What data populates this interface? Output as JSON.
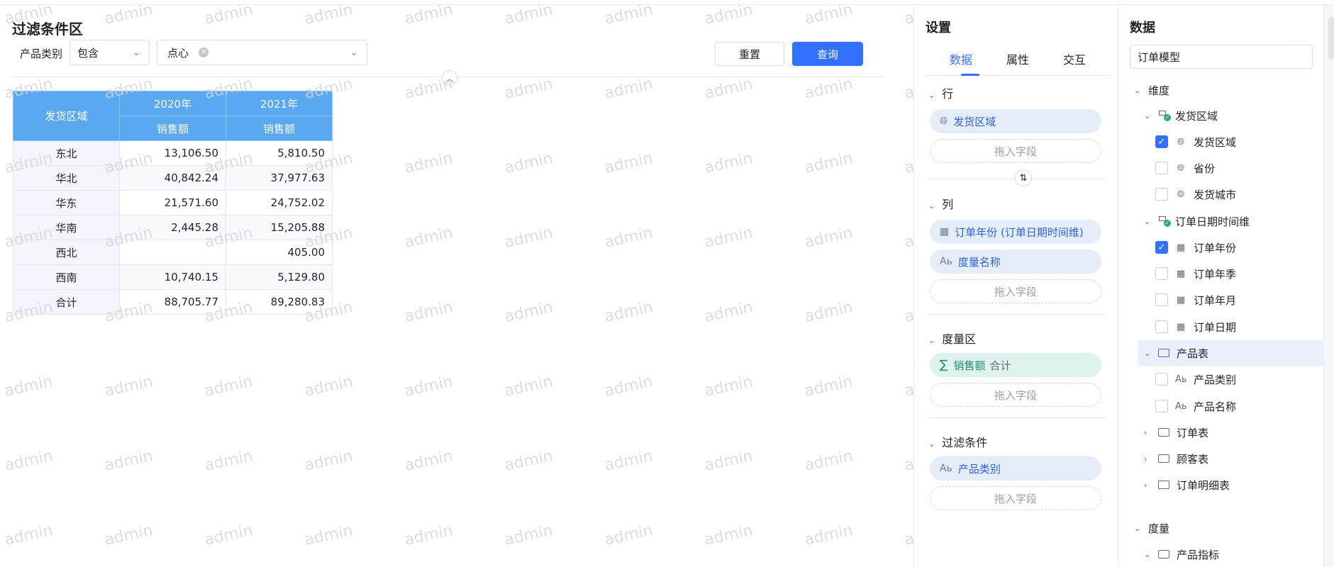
{
  "watermark_text": "admin",
  "filter": {
    "title": "过滤条件区",
    "label": "产品类别",
    "operator": "包含",
    "tag": "点心",
    "reset_label": "重置",
    "query_label": "查询"
  },
  "table": {
    "row_header": "发货区域",
    "years": [
      "2020年",
      "2021年"
    ],
    "measure": "销售额",
    "rows": [
      {
        "region": "东北",
        "v2020": "13,106.50",
        "v2021": "5,810.50"
      },
      {
        "region": "华北",
        "v2020": "40,842.24",
        "v2021": "37,977.63"
      },
      {
        "region": "华东",
        "v2020": "21,571.60",
        "v2021": "24,752.02"
      },
      {
        "region": "华南",
        "v2020": "2,445.28",
        "v2021": "15,205.88"
      },
      {
        "region": "西北",
        "v2020": "",
        "v2021": "405.00"
      },
      {
        "region": "西南",
        "v2020": "10,740.15",
        "v2021": "5,129.80"
      },
      {
        "region": "合计",
        "v2020": "88,705.77",
        "v2021": "89,280.83"
      }
    ]
  },
  "settings": {
    "title": "设置",
    "tabs": [
      "数据",
      "属性",
      "交互"
    ],
    "active_tab": "数据",
    "row_section": {
      "title": "行",
      "fields": [
        "发货区域"
      ]
    },
    "col_section": {
      "title": "列",
      "fields": [
        "订单年份 (订单日期时间维)",
        "度量名称"
      ]
    },
    "measure_section": {
      "title": "度量区",
      "field": "销售额",
      "agg": "合计"
    },
    "filter_section": {
      "title": "过滤条件",
      "field": "产品类别"
    },
    "drop_label": "拖入字段"
  },
  "data_panel": {
    "title": "数据",
    "model": "订单模型",
    "dimension_group": "维度",
    "tree": [
      {
        "label": "发货区域",
        "type": "hierarchy"
      },
      {
        "label": "发货区域",
        "type": "geo",
        "checked": true
      },
      {
        "label": "省份",
        "type": "geo",
        "checked": false
      },
      {
        "label": "发货城市",
        "type": "geo",
        "checked": false
      },
      {
        "label": "订单日期时间维",
        "type": "hierarchy"
      },
      {
        "label": "订单年份",
        "type": "date",
        "checked": true
      },
      {
        "label": "订单年季",
        "type": "date",
        "checked": false
      },
      {
        "label": "订单年月",
        "type": "date",
        "checked": false
      },
      {
        "label": "订单日期",
        "type": "date",
        "checked": false
      },
      {
        "label": "产品表",
        "type": "folder-open"
      },
      {
        "label": "产品类别",
        "type": "text",
        "checked": false
      },
      {
        "label": "产品名称",
        "type": "text",
        "checked": false
      },
      {
        "label": "订单表",
        "type": "folder"
      },
      {
        "label": "顾客表",
        "type": "folder"
      },
      {
        "label": "订单明细表",
        "type": "folder"
      }
    ],
    "measure_group": "度量",
    "measure_folder": "产品指标"
  },
  "colors": {
    "accent": "#3370ff",
    "header_blue": "#5aa8f0",
    "pill_blue": "#e5edfb",
    "pill_green": "#def3ee"
  }
}
